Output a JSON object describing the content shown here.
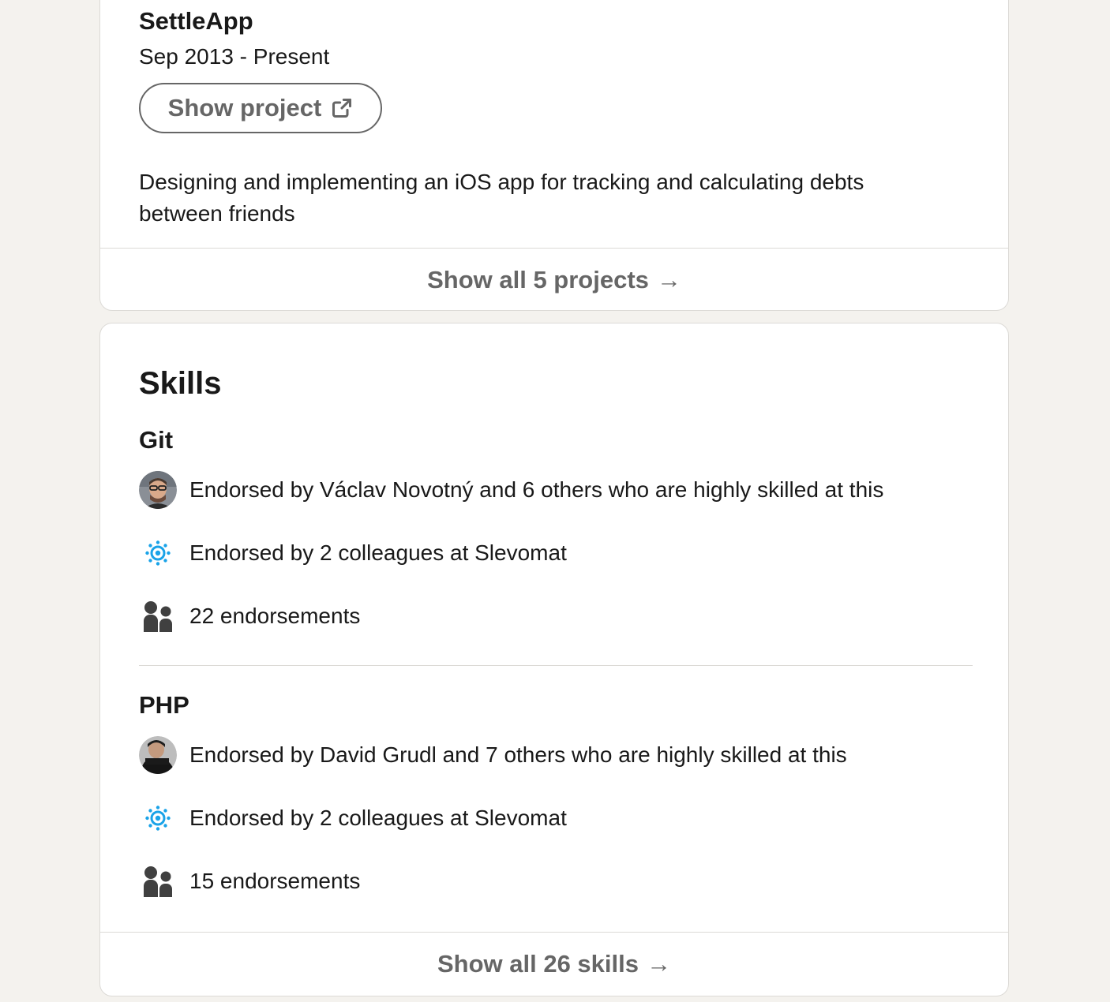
{
  "projects": {
    "title": "SettleApp",
    "date": "Sep 2013 - Present",
    "show_project_label": "Show project",
    "description": "Designing and implementing an iOS app for tracking and calculating debts between friends",
    "show_all_label": "Show all 5 projects",
    "arrow": "→"
  },
  "skills": {
    "heading": "Skills",
    "items": [
      {
        "name": "Git",
        "endorsed_by_text": "Endorsed by Václav Novotný and 6 others who are highly skilled at this",
        "colleagues_text": "Endorsed by 2 colleagues at Slevomat",
        "endorsements_text": "22 endorsements"
      },
      {
        "name": "PHP",
        "endorsed_by_text": "Endorsed by David Grudl and 7 others who are highly skilled at this",
        "colleagues_text": "Endorsed by 2 colleagues at Slevomat",
        "endorsements_text": "15 endorsements"
      }
    ],
    "show_all_label": "Show all 26 skills",
    "arrow": "→"
  },
  "icons": {
    "external_link": "external-link-icon",
    "company_logo": "slevomat-gear-icon",
    "people": "people-icon",
    "arrow_right": "arrow-right-icon"
  },
  "colors": {
    "background": "#f4f2ee",
    "card": "#ffffff",
    "text": "#191919",
    "muted": "#666666",
    "logo_blue": "#1aa3e8",
    "icon_dark": "#404040"
  }
}
